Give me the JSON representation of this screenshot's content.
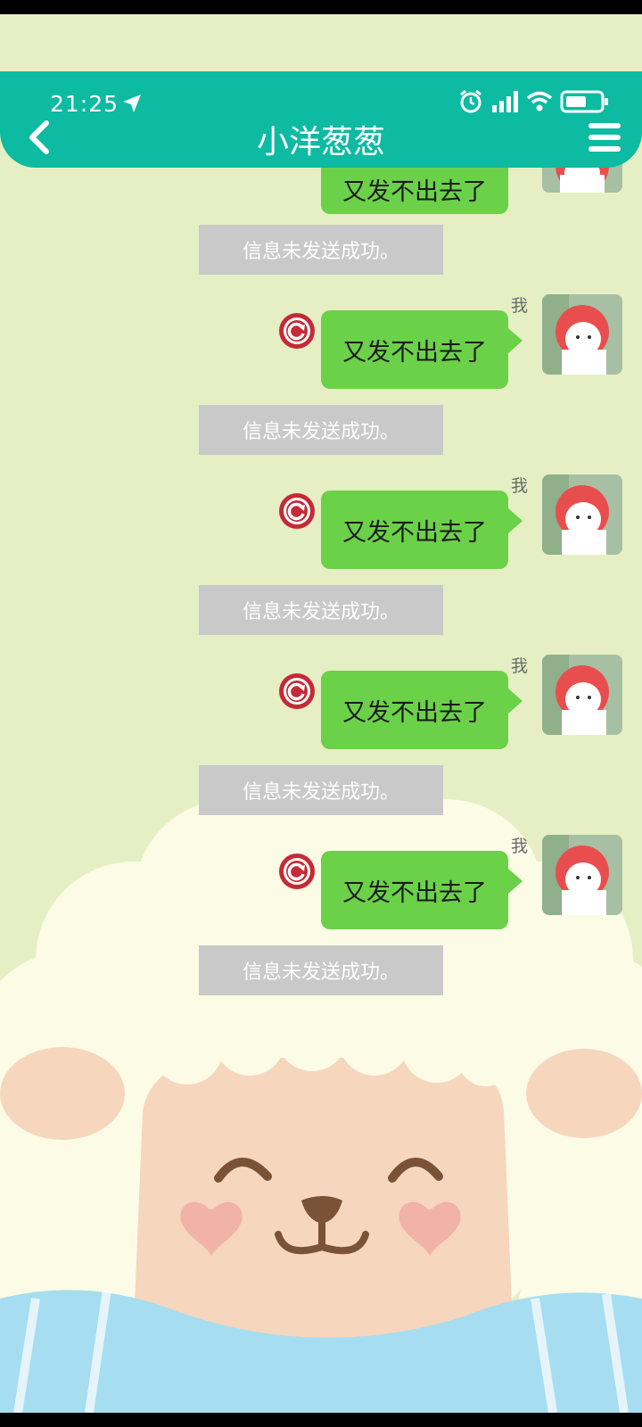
{
  "status_bar": {
    "time": "21:25"
  },
  "header": {
    "title": "小洋葱葱"
  },
  "messages": [
    {
      "text": "又发不出去了",
      "notice": "信息未发送成功。"
    },
    {
      "sender": "我",
      "text": "又发不出去了",
      "notice": "信息未发送成功。"
    },
    {
      "sender": "我",
      "text": "又发不出去了",
      "notice": "信息未发送成功。"
    },
    {
      "sender": "我",
      "text": "又发不出去了",
      "notice": "信息未发送成功。"
    },
    {
      "sender": "我",
      "text": "又发不出去了",
      "notice": "信息未发送成功。"
    }
  ],
  "colors": {
    "header": "#0dbaa2",
    "bubble": "#6bd148",
    "notice_bg": "#c9c9c9",
    "resend_icon": "#c52a36",
    "background": "#e6efc4"
  },
  "icons": [
    "navigation-arrow-icon",
    "alarm-icon",
    "signal-icon",
    "wifi-icon",
    "battery-icon",
    "back-icon",
    "menu-icon",
    "resend-icon"
  ]
}
